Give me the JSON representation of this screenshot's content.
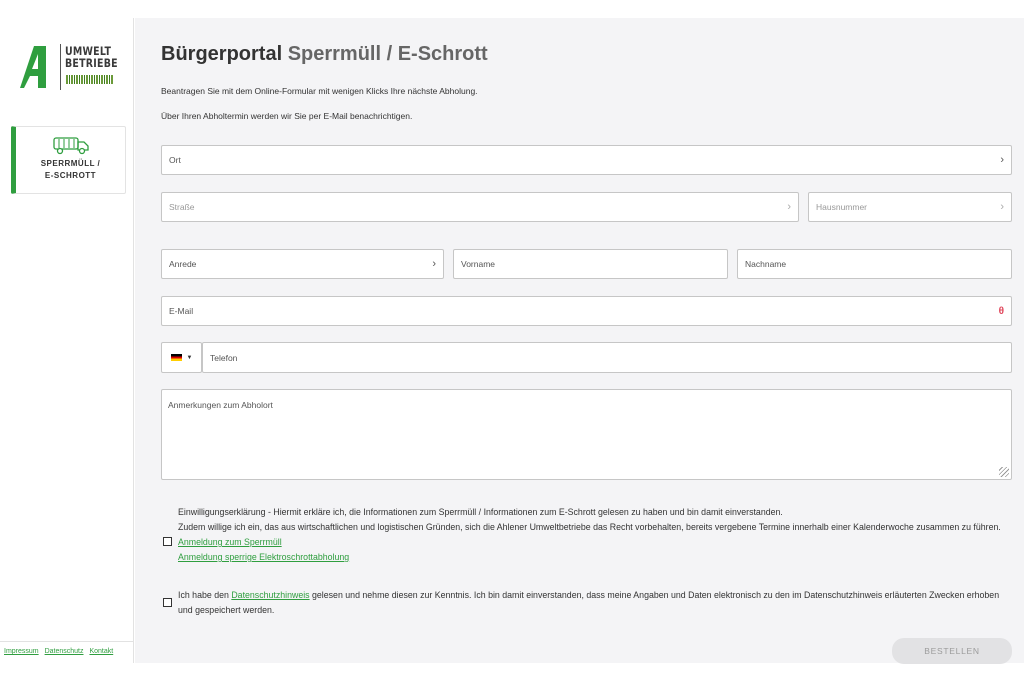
{
  "brand": {
    "line1": "UMWELT",
    "line2": "BETRIEBE",
    "accent": "#2f9e3f"
  },
  "nav": {
    "items": [
      {
        "label_line1": "SPERRMÜLL /",
        "label_line2": "E-SCHROTT",
        "icon": "garbage-truck-icon"
      }
    ]
  },
  "footer": {
    "links": [
      "Impressum",
      "Datenschutz",
      "Kontakt"
    ]
  },
  "header": {
    "title": "Bürgerportal",
    "subtitle": "Sperrmüll / E-Schrott"
  },
  "intro": {
    "line1": "Beantragen Sie mit dem Online-Formular mit wenigen Klicks Ihre nächste Abholung.",
    "line2": "Über Ihren Abholtermin werden wir Sie per E-Mail benachrichtigen."
  },
  "form": {
    "ort": "Ort",
    "strasse": "Straße",
    "hausnummer": "Hausnummer",
    "anrede": "Anrede",
    "vorname": "Vorname",
    "nachname": "Nachname",
    "email": "E-Mail",
    "telefon": "Telefon",
    "anmerkungen": "Anmerkungen zum Abholort"
  },
  "consent": {
    "text1": "Einwilligungserklärung - Hiermit erkläre ich, die Informationen zum Sperrmüll / Informationen zum E-Schrott gelesen zu haben und bin damit einverstanden.",
    "text2": "Zudem willige ich ein, das aus wirtschaftlichen und logistischen Gründen, sich die Ahlener Umweltbetriebe das Recht vorbehalten, bereits vergebene Termine innerhalb einer Kalenderwoche zusammen zu führen.",
    "link1": "Anmeldung zum Sperrmüll",
    "link2": "Anmeldung sperrige Elektroschrottabholung",
    "privacy_before": "Ich habe den ",
    "privacy_link": "Datenschutzhinweis",
    "privacy_after": " gelesen und nehme diesen zur Kenntnis. Ich bin damit einverstanden, dass meine Angaben und Daten elektronisch zu den im Datenschutzhinweis erläuterten Zwecken erhoben und gespeichert werden."
  },
  "submit": {
    "label": "BESTELLEN"
  }
}
